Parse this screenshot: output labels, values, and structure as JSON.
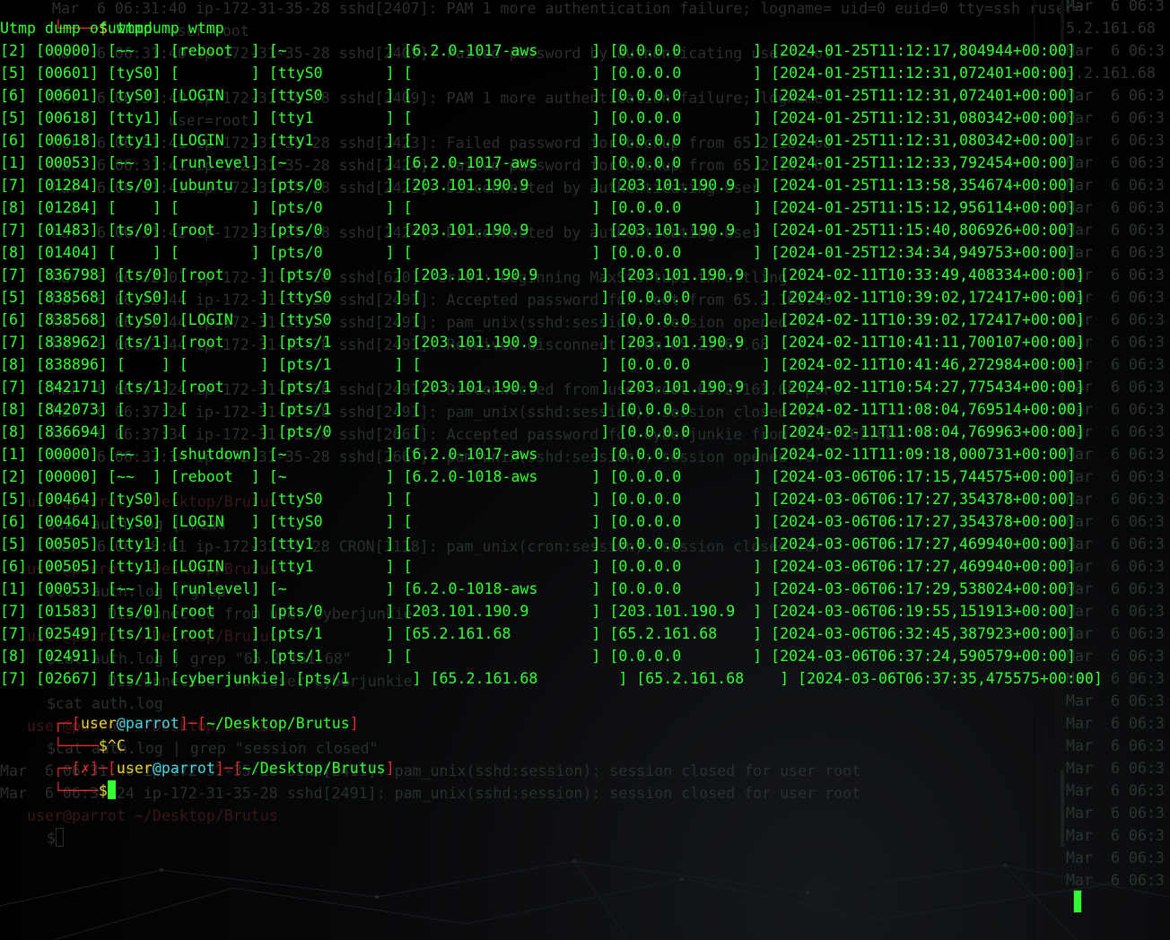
{
  "terminal": {
    "command_line": {
      "prompt_symbol": "$",
      "command": "utmpdump wtmp"
    },
    "header": "Utmp dump of wtmp",
    "records": [
      "[2] [00000] [~~  ] [reboot  ] [~           ] [6.2.0-1017-aws      ] [0.0.0.0        ] [2024-01-25T11:12:17,804944+00:00]",
      "[5] [00601] [tyS0] [        ] [ttyS0       ] [                    ] [0.0.0.0        ] [2024-01-25T11:12:31,072401+00:00]",
      "[6] [00601] [tyS0] [LOGIN   ] [ttyS0       ] [                    ] [0.0.0.0        ] [2024-01-25T11:12:31,072401+00:00]",
      "[5] [00618] [tty1] [        ] [tty1        ] [                    ] [0.0.0.0        ] [2024-01-25T11:12:31,080342+00:00]",
      "[6] [00618] [tty1] [LOGIN   ] [tty1        ] [                    ] [0.0.0.0        ] [2024-01-25T11:12:31,080342+00:00]",
      "[1] [00053] [~~  ] [runlevel] [~           ] [6.2.0-1017-aws      ] [0.0.0.0        ] [2024-01-25T11:12:33,792454+00:00]",
      "[7] [01284] [ts/0] [ubuntu  ] [pts/0       ] [203.101.190.9       ] [203.101.190.9  ] [2024-01-25T11:13:58,354674+00:00]",
      "[8] [01284] [    ] [        ] [pts/0       ] [                    ] [0.0.0.0        ] [2024-01-25T11:15:12,956114+00:00]",
      "[7] [01483] [ts/0] [root    ] [pts/0       ] [203.101.190.9       ] [203.101.190.9  ] [2024-01-25T11:15:40,806926+00:00]",
      "[8] [01404] [    ] [        ] [pts/0       ] [                    ] [0.0.0.0        ] [2024-01-25T12:34:34,949753+00:00]",
      "[7] [836798] [ts/0] [root    ] [pts/0       ] [203.101.190.9       ] [203.101.190.9  ] [2024-02-11T10:33:49,408334+00:00]",
      "[5] [838568] [tyS0] [        ] [ttyS0       ] [                    ] [0.0.0.0        ] [2024-02-11T10:39:02,172417+00:00]",
      "[6] [838568] [tyS0] [LOGIN   ] [ttyS0       ] [                    ] [0.0.0.0        ] [2024-02-11T10:39:02,172417+00:00]",
      "[7] [838962] [ts/1] [root    ] [pts/1       ] [203.101.190.9       ] [203.101.190.9  ] [2024-02-11T10:41:11,700107+00:00]",
      "[8] [838896] [    ] [        ] [pts/1       ] [                    ] [0.0.0.0        ] [2024-02-11T10:41:46,272984+00:00]",
      "[7] [842171] [ts/1] [root    ] [pts/1       ] [203.101.190.9       ] [203.101.190.9  ] [2024-02-11T10:54:27,775434+00:00]",
      "[8] [842073] [    ] [        ] [pts/1       ] [                    ] [0.0.0.0        ] [2024-02-11T11:08:04,769514+00:00]",
      "[8] [836694] [    ] [        ] [pts/0       ] [                    ] [0.0.0.0        ] [2024-02-11T11:08:04,769963+00:00]",
      "[1] [00000] [~~  ] [shutdown] [~           ] [6.2.0-1017-aws      ] [0.0.0.0        ] [2024-02-11T11:09:18,000731+00:00]",
      "[2] [00000] [~~  ] [reboot  ] [~           ] [6.2.0-1018-aws      ] [0.0.0.0        ] [2024-03-06T06:17:15,744575+00:00]",
      "[5] [00464] [tyS0] [        ] [ttyS0       ] [                    ] [0.0.0.0        ] [2024-03-06T06:17:27,354378+00:00]",
      "[6] [00464] [tyS0] [LOGIN   ] [ttyS0       ] [                    ] [0.0.0.0        ] [2024-03-06T06:17:27,354378+00:00]",
      "[5] [00505] [tty1] [        ] [tty1        ] [                    ] [0.0.0.0        ] [2024-03-06T06:17:27,469940+00:00]",
      "[6] [00505] [tty1] [LOGIN   ] [tty1        ] [                    ] [0.0.0.0        ] [2024-03-06T06:17:27,469940+00:00]",
      "[1] [00053] [~~  ] [runlevel] [~           ] [6.2.0-1018-aws      ] [0.0.0.0        ] [2024-03-06T06:17:29,538024+00:00]",
      "[7] [01583] [ts/0] [root    ] [pts/0       ] [203.101.190.9       ] [203.101.190.9  ] [2024-03-06T06:19:55,151913+00:00]",
      "[7] [02549] [ts/1] [root    ] [pts/1       ] [65.2.161.68         ] [65.2.161.68    ] [2024-03-06T06:32:45,387923+00:00]",
      "[8] [02491] [    ] [        ] [pts/1       ] [                    ] [0.0.0.0        ] [2024-03-06T06:37:24,590579+00:00]",
      "[7] [02667] [ts/1] [cyberjunkie] [pts/1       ] [65.2.161.68         ] [65.2.161.68    ] [2024-03-06T06:37:35,475575+00:00]"
    ],
    "prompt1": {
      "user": "user",
      "at": "@",
      "host": "parrot",
      "path": "~/Desktop/Brutus",
      "input": "$^C"
    },
    "prompt2": {
      "error_mark": "✗",
      "user": "user",
      "at": "@",
      "host": "parrot",
      "path": "~/Desktop/Brutus",
      "input": "$"
    },
    "colors": {
      "output": "#33ff33",
      "bracket": "#e02a2a",
      "user": "#e8d22a",
      "host": "#48d6e0"
    }
  },
  "background_terminal": {
    "lines": [
      "Mar  6 06:31:40 ip-172-31-35-28 sshd[2407]: PAM 1 more authentication failure; logname= uid=0 euid=0 tty=ssh ruser=",
      "             user=root",
      "Mar  6 06:31:40 ip-172-31-35-28 sshd[2409]: Failed password by authenticating user root",
      "Mar  6 06:31:40 ip-172-31-35-28 sshd[2409]: PAM 1 more authentication failure; logname",
      "             user=root",
      "Mar  6 06:31:41 ip-172-31-35-28 sshd[2423]: Failed password for backup from 65.2.161.68",
      "Mar  6 06:31:41 ip-172-31-35-28 sshd[2424]: Failed password for backup from 65.2.161.68",
      "Mar  6 06:31:41 ip-172-31-35-28 sshd[2423]: Disconnected by authenticating user",
      "Mar  6 06:31:42 ip-172-31-35-28 sshd[2424]: Disconnected by authenticating user",
      "Mar  6 06:32:01 ip-172-31-35-28 sshd[620]: error: beginning MaxStartups throttling",
      "Mar  6 06:32:44 ip-172-31-35-28 sshd[2491]: Accepted password for root from 65.2.161.68",
      "Mar  6 06:32:44 ip-172-31-35-28 sshd[2491]: pam_unix(sshd:session): session opened for",
      "Mar  6 06:32:44 ip-172-31-35-28 sshd[2491]: Received disconnect from 65.2.161.68",
      "Mar  6 06:37:24 ip-172-31-35-28 sshd[2491]: Disconnected from user root 65.2.161.68 port",
      "Mar  6 06:37:24 ip-172-31-35-28 sshd[2491]: pam_unix(sshd:session): session closed for",
      "Mar  6 06:37:34 ip-172-31-35-28 sshd[2667]: Accepted password for cyberjunkie from 65.2.161.68",
      "Mar  6 06:37:34 ip-172-31-35-28 sshd[2667]: pam_unix(sshd:session): session opened for",
      "user@parrot ~/Desktop/Brutus",
      "$cat auth.log | head",
      "Mar  6 06:18:01 ip-172-31-35-28 CRON[1118]: pam_unix(cron:session): session closed for",
      "user@parrot ~/Desktop/Brutus",
      "$cat auth.log | grep",
      "Disconnected from user cyberjunkie",
      "user@parrot ~/Desktop/Brutus",
      "$cat auth.log | grep \"65.2.161.68\"",
      "Disconnected from user cyberjunkie",
      "$cat auth.log",
      "user@parrot ~/Desktop/Brutus",
      "$cat auth.log | grep \"session closed\"",
      "Mar  6 06:31:40 ip-172-31-35-28 sshd[2411]: pam_unix(sshd:session): session closed for user root",
      "Mar  6 06:37:24 ip-172-31-35-28 sshd[2491]: pam_unix(sshd:session): session closed for user root",
      "user@parrot ~/Desktop/Brutus",
      "$"
    ]
  },
  "right_pane": {
    "lines": [
      "Mar  6 06:3",
      "5.2.161.68",
      "Mar  6 06:3",
      "5.2.161.68",
      "Mar  6 06:3",
      "Mar  6 06:3",
      "Mar  6 06:3",
      "Mar  6 06:3",
      "Mar  6 06:3",
      "Mar  6 06:3",
      "Mar  6 06:3",
      "Mar  6 06:3",
      "Mar  6 06:3",
      "Mar  6 06:3",
      "Mar  6 06:3",
      "Mar  6 06:3",
      "Mar  6 06:3",
      "Mar  6 06:3",
      "Mar  6 06:3",
      "Mar  6 06:3",
      "Mar  6 06:3",
      "Mar  6 06:3",
      "Mar  6 06:3",
      "Mar  6 06:3",
      "Mar  6 06:3",
      "Mar  6 06:3",
      "Mar  6 06:3",
      "Mar  6 06:3",
      "Mar  6 06:3",
      "Mar  6 06:3",
      "Mar  6 06:3",
      "Mar  6 06:3",
      "Mar  6 06:3",
      "Mar  6 06:3",
      "Mar  6 06:3",
      "Mar  6 06:3",
      "Mar  6 06:3",
      "Mar  6 06:3",
      "Mar  6 06:3",
      "Mar  6 06:3"
    ]
  }
}
